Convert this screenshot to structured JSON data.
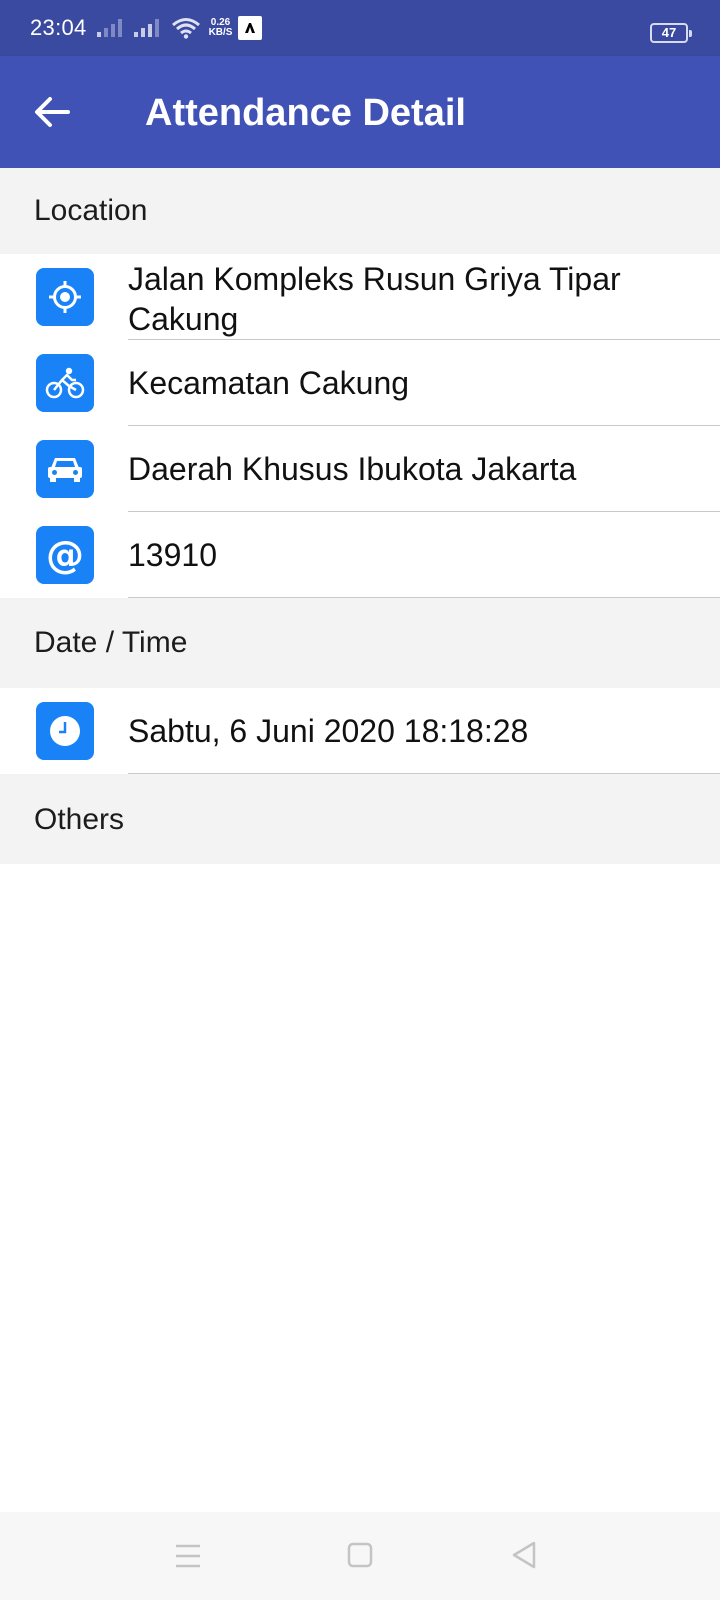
{
  "status_bar": {
    "time": "23:04",
    "net_speed_value": "0.26",
    "net_speed_unit": "KB/S",
    "battery_level": "47",
    "icons": [
      "signal-icon",
      "signal-icon",
      "wifi-icon",
      "app-notification-icon",
      "battery-icon"
    ]
  },
  "toolbar": {
    "title": "Attendance Detail",
    "back_icon": "arrow-back-icon",
    "color": "#4152b6"
  },
  "sections": {
    "location": {
      "header": "Location",
      "rows": [
        {
          "icon": "gps-target-icon",
          "text": "Jalan Kompleks Rusun Griya Tipar Cakung"
        },
        {
          "icon": "bicycle-icon",
          "text": "Kecamatan Cakung"
        },
        {
          "icon": "car-icon",
          "text": "Daerah Khusus Ibukota Jakarta"
        },
        {
          "icon": "at-sign-icon",
          "text": "13910"
        }
      ]
    },
    "datetime": {
      "header": "Date / Time",
      "rows": [
        {
          "icon": "clock-icon",
          "text": "Sabtu, 6 Juni 2020 18:18:28"
        }
      ]
    },
    "others": {
      "header": "Others"
    }
  },
  "colors": {
    "status_bar": "#3a4aa0",
    "icon_background": "#1a82f7",
    "section_background": "#f3f3f3"
  },
  "nav_bar": {
    "icons": [
      "menu-icon",
      "home-square-icon",
      "back-triangle-icon"
    ]
  }
}
